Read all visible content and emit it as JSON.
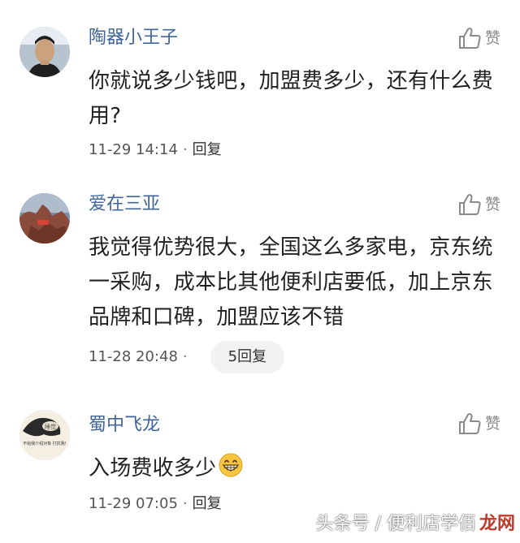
{
  "comments": [
    {
      "username": "陶器小王子",
      "text": "你就说多少钱吧，加盟费多少，还有什么费用?",
      "time": "11-29 14:14",
      "separator": "·",
      "reply": "回复",
      "like_label": "赞"
    },
    {
      "username": "爱在三亚",
      "text": "我觉得优势很大，全国这么多家电，京东统一采购，成本比其他便利店要低，加上京东品牌和口碑，加盟应该不错",
      "time": "11-28 20:48",
      "separator": "·",
      "reply": "5回复",
      "like_label": "赞"
    },
    {
      "username": "蜀中飞龙",
      "text": "入场费收多少",
      "time": "11-29 07:05",
      "separator": "·",
      "reply": "回复",
      "like_label": "赞"
    }
  ],
  "icons": {
    "like": "thumbs-up-icon",
    "emoji": "grinning-face-icon"
  },
  "avatar_text": {
    "third_top": "睡觉",
    "third_bottom": "不给我介绍对象 打扰我!"
  },
  "watermark": {
    "left": "头条号 / 便利店学佰",
    "right": "龙网"
  },
  "colors": {
    "username": "#406599",
    "text": "#222222",
    "meta": "#555555",
    "pill_bg": "#f2f2f2"
  }
}
